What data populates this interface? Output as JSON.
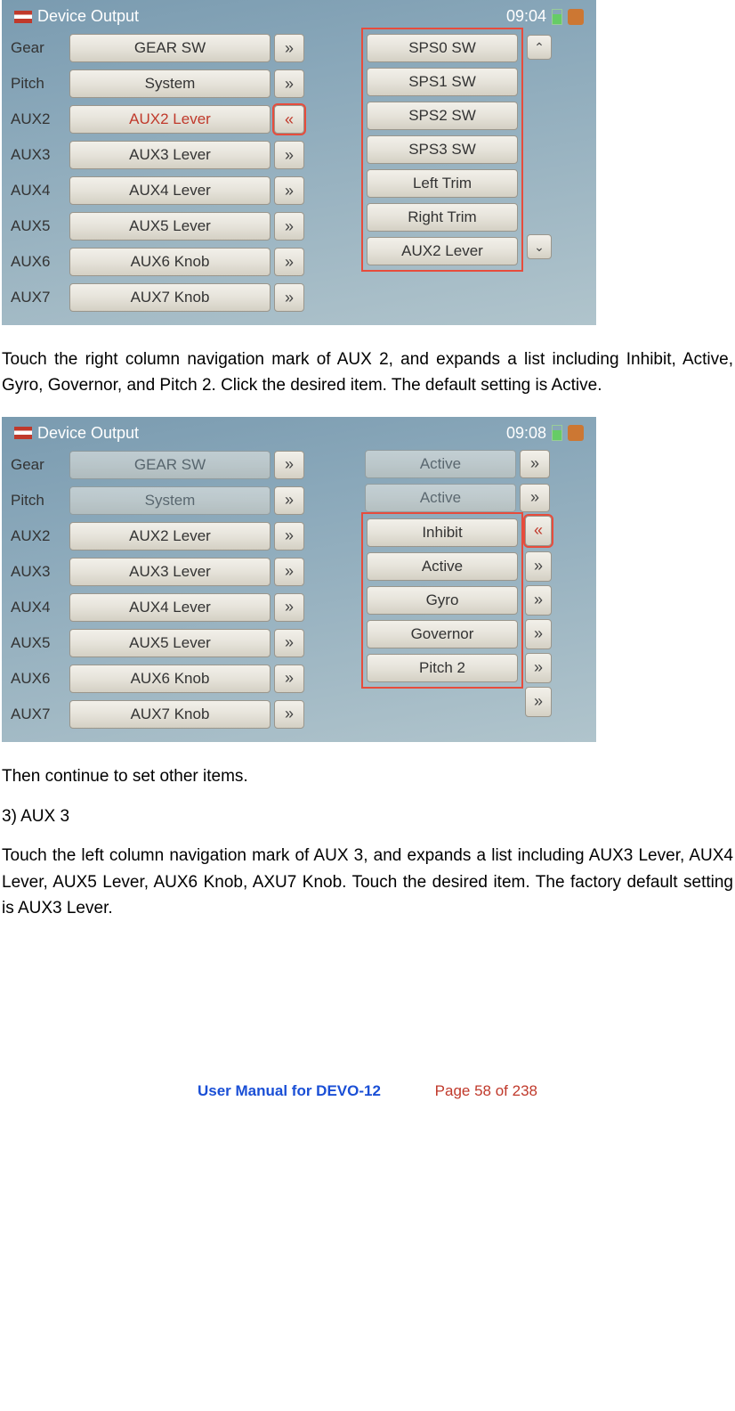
{
  "screenshot1": {
    "title": "Device Output",
    "clock": "09:04",
    "left_rows": [
      {
        "label": "Gear",
        "btn": "GEAR SW",
        "nav": "»",
        "nav_red": false,
        "red_text": false
      },
      {
        "label": "Pitch",
        "btn": "System",
        "nav": "»",
        "nav_red": false,
        "red_text": false
      },
      {
        "label": "AUX2",
        "btn": "AUX2 Lever",
        "nav": "«",
        "nav_red": true,
        "red_text": true
      },
      {
        "label": "AUX3",
        "btn": "AUX3 Lever",
        "nav": "»",
        "nav_red": false,
        "red_text": false
      },
      {
        "label": "AUX4",
        "btn": "AUX4 Lever",
        "nav": "»",
        "nav_red": false,
        "red_text": false
      },
      {
        "label": "AUX5",
        "btn": "AUX5 Lever",
        "nav": "»",
        "nav_red": false,
        "red_text": false
      },
      {
        "label": "AUX6",
        "btn": "AUX6 Knob",
        "nav": "»",
        "nav_red": false,
        "red_text": false
      },
      {
        "label": "AUX7",
        "btn": "AUX7 Knob",
        "nav": "»",
        "nav_red": false,
        "red_text": false
      }
    ],
    "right_items": [
      "SPS0 SW",
      "SPS1 SW",
      "SPS2 SW",
      "SPS3 SW",
      "Left Trim",
      "Right Trim",
      "AUX2 Lever"
    ],
    "scroll_up": "⌃",
    "scroll_down": "⌄"
  },
  "para1": "Touch the right column navigation mark of AUX 2, and expands a list including Inhibit, Active, Gyro, Governor, and Pitch 2. Click the desired item. The default setting is Active.",
  "screenshot2": {
    "title": "Device Output",
    "clock": "09:08",
    "left_rows": [
      {
        "label": "Gear",
        "btn": "GEAR SW",
        "nav": "»",
        "dim": true
      },
      {
        "label": "Pitch",
        "btn": "System",
        "nav": "»",
        "dim": true
      },
      {
        "label": "AUX2",
        "btn": "AUX2 Lever",
        "nav": "»",
        "dim": false
      },
      {
        "label": "AUX3",
        "btn": "AUX3 Lever",
        "nav": "»",
        "dim": false
      },
      {
        "label": "AUX4",
        "btn": "AUX4 Lever",
        "nav": "»",
        "dim": false
      },
      {
        "label": "AUX5",
        "btn": "AUX5 Lever",
        "nav": "»",
        "dim": false
      },
      {
        "label": "AUX6",
        "btn": "AUX6 Knob",
        "nav": "»",
        "dim": false
      },
      {
        "label": "AUX7",
        "btn": "AUX7 Knob",
        "nav": "»",
        "dim": false
      }
    ],
    "right_top": [
      {
        "btn": "Active",
        "nav": "»",
        "dim": true
      },
      {
        "btn": "Active",
        "nav": "»",
        "dim": true
      }
    ],
    "right_open_nav": "«",
    "right_menu": [
      "Inhibit",
      "Active",
      "Gyro",
      "Governor",
      "Pitch 2"
    ],
    "right_side_navs": [
      "»",
      "»",
      "»",
      "»",
      "»"
    ]
  },
  "para2": "Then continue to set other items.",
  "heading3": "3)    AUX 3",
  "para3": "Touch the left column navigation mark of AUX 3, and expands a list including AUX3 Lever, AUX4 Lever, AUX5 Lever, AUX6 Knob, AXU7 Knob. Touch the desired item. The factory default setting is AUX3 Lever.",
  "footer": {
    "manual": "User Manual for DEVO-12",
    "page": "Page 58 of 238"
  }
}
